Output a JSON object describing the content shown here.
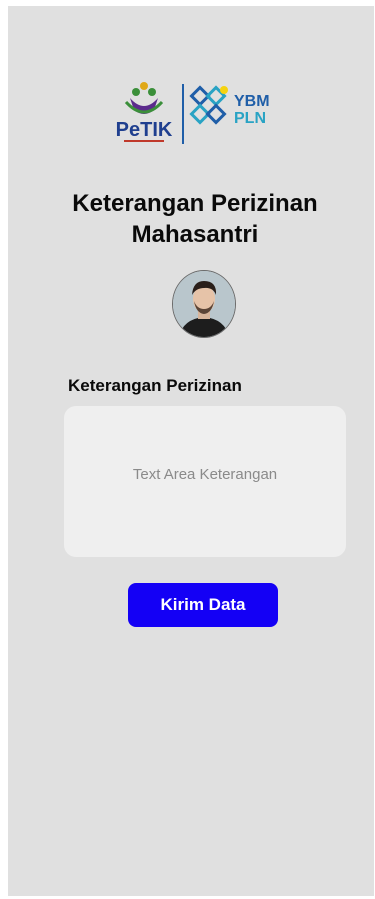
{
  "header": {
    "logo_left_text": "PeTIK",
    "logo_right_top": "YBM",
    "logo_right_bottom": "PLN",
    "title": "Keterangan Perizinan Mahasantri"
  },
  "form": {
    "label": "Keterangan Perizinan",
    "textarea_placeholder": "Text Area Keterangan",
    "submit_label": "Kirim Data"
  },
  "colors": {
    "background": "#e0e0e0",
    "button": "#1400f5",
    "logo_blue": "#1f5ea8",
    "logo_cyan": "#29a3c4",
    "logo_yellow": "#f5d311"
  }
}
